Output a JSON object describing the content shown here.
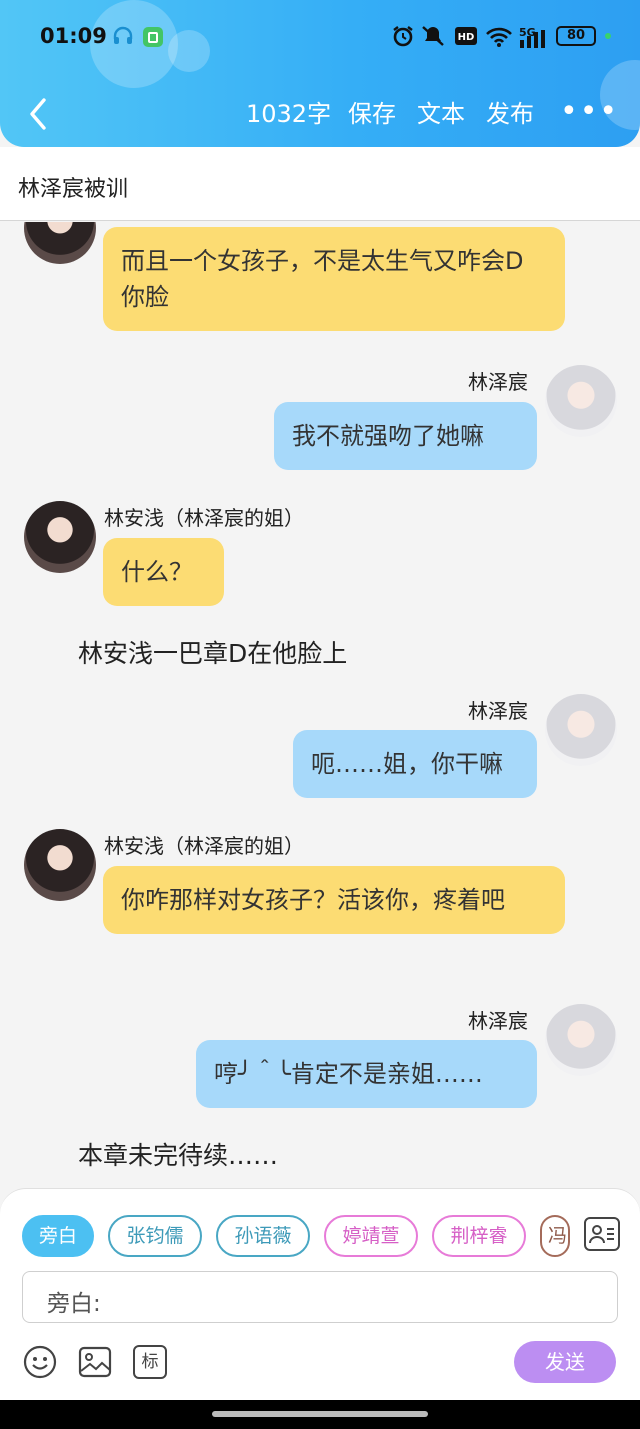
{
  "status_bar": {
    "time": "01:09",
    "network": "5G",
    "battery": "80"
  },
  "navbar": {
    "word_count": "1032字",
    "save": "保存",
    "text": "文本",
    "publish": "发布",
    "more": "•••"
  },
  "chapter": {
    "title": "林泽宸被训"
  },
  "messages": [
    {
      "side": "left",
      "text": "而且一个女孩子，不是太生气又咋会D你脸"
    },
    {
      "side": "right",
      "name": "林泽宸",
      "text": "我不就强吻了她嘛"
    },
    {
      "side": "left",
      "name": "林安浅（林泽宸的姐）",
      "text": "什么？"
    },
    {
      "type": "narration",
      "text": "林安浅一巴章D在他脸上"
    },
    {
      "side": "right",
      "name": "林泽宸",
      "text": "呃……姐，你干嘛"
    },
    {
      "side": "left",
      "name": "林安浅（林泽宸的姐）",
      "text": "你咋那样对女孩子？活该你，疼着吧"
    },
    {
      "side": "right",
      "name": "林泽宸",
      "text": "哼╯＾╰肯定不是亲姐……"
    },
    {
      "type": "narration",
      "text": "本章未完待续……"
    }
  ],
  "composer": {
    "chips": [
      "旁白",
      "张钧儒",
      "孙语薇",
      "婷靖萱",
      "荆梓睿",
      "冯"
    ],
    "input_label": "旁白:",
    "tag_label": "标",
    "send_label": "发送"
  }
}
